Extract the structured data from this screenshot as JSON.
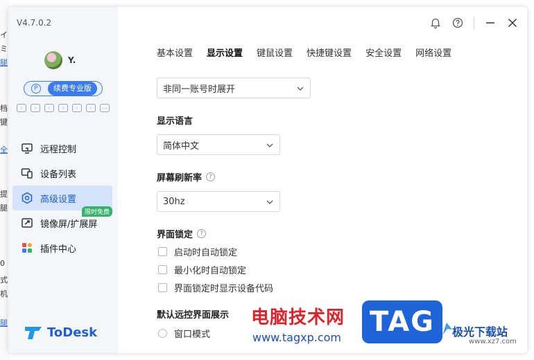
{
  "background_window": {
    "fragments": [
      "イ",
      "ミ当",
      "腿",
      "档",
      "键",
      "全",
      "提",
      "腿",
      "0",
      "式",
      "机",
      "腿"
    ]
  },
  "sidebar": {
    "version": "V4.7.0.2",
    "username": "Y.",
    "vip_label": "续费专业版",
    "vip_icon": "P",
    "nav": [
      {
        "label": "远程控制",
        "icon": "monitor-icon"
      },
      {
        "label": "设备列表",
        "icon": "devices-icon"
      },
      {
        "label": "高级设置",
        "icon": "settings-icon",
        "active": true
      },
      {
        "label": "镜像屏/扩展屏",
        "icon": "mirror-icon",
        "tag": "限时免费"
      },
      {
        "label": "插件中心",
        "icon": "plugin-icon"
      }
    ],
    "logo_text": "ToDesk"
  },
  "tabs": [
    "基本设置",
    "显示设置",
    "键鼠设置",
    "快捷键设置",
    "安全设置",
    "网络设置"
  ],
  "active_tab": "显示设置",
  "display": {
    "window_mode_value": "非同一账号时展开",
    "language_title": "显示语言",
    "language_value": "简体中文",
    "refresh_title": "屏幕刷新率",
    "refresh_value": "30hz",
    "lock_title": "界面锁定",
    "lock_options": [
      "启动时自动锁定",
      "最小化时自动锁定",
      "界面锁定时显示设备代码"
    ],
    "remote_view_title": "默认远控界面展示",
    "remote_view_option": "窗口模式"
  },
  "watermark": {
    "text": "电脑技术网",
    "url": "www.tagxp.com",
    "tag": "TAG",
    "site": "极光下载站",
    "site_url": "www.xz7.com"
  },
  "colors": {
    "accent": "#1f5fd6",
    "active_bg": "#d5e3fb",
    "free_tag": "#35b36a"
  }
}
